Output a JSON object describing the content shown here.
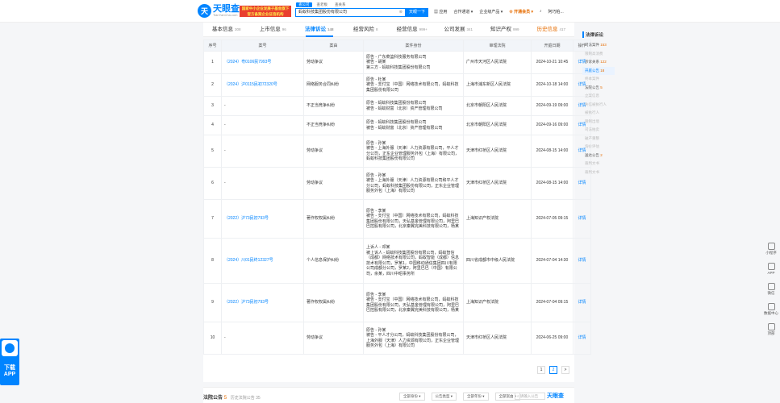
{
  "header": {
    "logo_cn": "天眼查",
    "logo_en": "TianYanCha.com",
    "banner_line1": "国家中小企业发展子基金旗下",
    "banner_line2": "官方备案企业征信机构",
    "search_tabs": [
      "查公司",
      "查老板",
      "查关系"
    ],
    "search_value": "蚂蚁科技集团股份有限公司",
    "search_button": "天眼一下",
    "nav": [
      "应用",
      "合作通道",
      "企业级产品",
      "开通会员",
      "阿巧柏..."
    ]
  },
  "tabs": [
    {
      "label": "基本信息",
      "count": "308"
    },
    {
      "label": "上市信息",
      "count": "96"
    },
    {
      "label": "法律诉讼",
      "count": "148"
    },
    {
      "label": "经营风险",
      "count": "8"
    },
    {
      "label": "经营信息",
      "count": "999+"
    },
    {
      "label": "公司发展",
      "count": "341"
    },
    {
      "label": "知识产权",
      "count": "999"
    },
    {
      "label": "历史信息",
      "count": "417"
    }
  ],
  "table": {
    "headers": [
      "序号",
      "案号",
      "案由",
      "案件身份",
      "审理法院",
      "开庭日期",
      "操作"
    ],
    "rows": [
      {
        "no": "1",
        "case": "（2024）粤0106民7993号",
        "cause": "劳动争议",
        "parties": "原告 - 广东菜篮科技服务有限公司\n被告 - 胡某\n第三方 - 蚂蚁科技集团股份有限公司",
        "court": "广州市天河区人民法院",
        "date": "2024-10-21 10:45",
        "op": "详情"
      },
      {
        "no": "2",
        "case": "（2024）沪0115民初72320号",
        "cause": "网络服务合同纠纷",
        "parties": "原告 - 杜某\n被告 - 支付宝（中国）网络技术有限公司，蚂蚁科技集团股份有限公司",
        "court": "上海市浦东新区人民法院",
        "date": "2024-10-18 14:00",
        "op": "详情"
      },
      {
        "no": "3",
        "case": "-",
        "cause": "不正当竞争纠纷",
        "parties": "原告 - 蚂蚁科技集团股份有限公司\n被告 - 蚂蚁财富（北京）资产管理有限公司",
        "court": "北京市朝阳区人民法院",
        "date": "2024-09-19 09:00",
        "op": "详情"
      },
      {
        "no": "4",
        "case": "-",
        "cause": "不正当竞争纠纷",
        "parties": "原告 - 蚂蚁科技集团股份有限公司\n被告 - 蚂蚁财富（北京）资产管理有限公司",
        "court": "北京市朝阳区人民法院",
        "date": "2024-09-16 09:00",
        "op": "详情"
      },
      {
        "no": "5",
        "case": "-",
        "cause": "劳动争议",
        "parties": "原告 - 孙某\n被告 - 上海外服（天津）人力资源有限公司，平人才分公司，正东企业管理服务外包（上海）有限公司，蚂蚁科技集团股份有限公司",
        "court": "天津市红桥区人民法院",
        "date": "2024-08-15 14:00",
        "op": "详情"
      },
      {
        "no": "6",
        "case": "-",
        "cause": "劳动争议",
        "parties": "原告 - 孙某\n被告 - 上海外服（天津）人力资源有限公司和平人才分公司，蚂蚁科技集团股份有限公司，正东企业管理服务外包（上海）有限公司",
        "court": "天津市红桥区人民法院",
        "date": "2024-08-15 14:00",
        "op": "详情"
      },
      {
        "no": "7",
        "case": "（2022）沪73民初793号",
        "cause": "著作权权属纠纷",
        "parties": "原告 - 李某\n被告 - 支付宝（中国）网络技术有限公司，蚂蚁科技集团股份有限公司，天弘基金管理有限公司，阿里巴巴控股有限公司，北京秦翼完美科技有限公司，杨某",
        "court": "上海知识产权法院",
        "date": "2024-07-05 09:15",
        "op": "详情"
      },
      {
        "no": "8",
        "case": "（2024）川01民终12327号",
        "cause": "个人信息保护纠纷",
        "parties": "上诉人 - 邓某\n被上诉人 - 蚂蚁科技集团股份有限公司，蚂蚁智信（成都）网络技术有限公司，蚂蚁智能（成都）信息技术有限公司，罗某1，中国移动通信集团四川有限公司成都分公司，罗某2，阿里巴巴（中国）有限公司，余某，四川中昭事务所",
        "court": "四川省成都市中级人民法院",
        "date": "2024-07-04 14:30",
        "op": "详情"
      },
      {
        "no": "9",
        "case": "（2022）沪73民初793号",
        "cause": "著作权权属纠纷",
        "parties": "原告 - 李某\n被告 - 支付宝（中国）网络技术有限公司，蚂蚁科技集团股份有限公司，天弘基金管理有限公司，阿里巴巴控股有限公司，北京秦翼完美科技有限公司，杨某",
        "court": "上海知识产权法院",
        "date": "2024-07-04 09:15",
        "op": "详情"
      },
      {
        "no": "10",
        "case": "-",
        "cause": "劳动争议",
        "parties": "原告 - 孙某\n被告 - 平人才分公司，蚂蚁科技集团股份有限公司，上海外服（天津）人力资源有限公司，正东企业管理服务外包（上海）有限公司",
        "court": "天津市红桥区人民法院",
        "date": "2024-06-25 09:00",
        "op": "详情"
      }
    ]
  },
  "pager": [
    "1",
    "2",
    ">"
  ],
  "bottom": {
    "title": "法院公告",
    "count": "5",
    "sub": "历史法院公告 35",
    "filters": [
      "全部身份",
      "公告类型",
      "全部年份",
      "全部案由"
    ],
    "search_placeholder": "请输入公告",
    "brand": "天眼查"
  },
  "sidebar": {
    "title": "法律诉讼",
    "items": [
      {
        "label": "司法案件",
        "n": "153"
      },
      {
        "label": "限制高消费",
        "n": ""
      },
      {
        "label": "涉诉关系",
        "n": "122"
      },
      {
        "label": "开庭公告",
        "n": "18"
      },
      {
        "label": "终本案件",
        "n": ""
      },
      {
        "label": "法院公告",
        "n": "5"
      },
      {
        "label": "立案信息",
        "n": ""
      },
      {
        "label": "失信被执行人",
        "n": ""
      },
      {
        "label": "被执行人",
        "n": ""
      },
      {
        "label": "限制出境",
        "n": ""
      },
      {
        "label": "司法拍卖",
        "n": ""
      },
      {
        "label": "破产重整",
        "n": ""
      },
      {
        "label": "询价评估",
        "n": ""
      },
      {
        "label": "送达公告",
        "n": "2"
      },
      {
        "label": "裁判文书",
        "n": ""
      },
      {
        "label": "裁判文书",
        "n": ""
      }
    ]
  },
  "right_tools": [
    "小程序",
    "APP",
    "微信",
    "数据中心",
    "顶部"
  ],
  "left_app": {
    "line1": "下载",
    "line2": "APP"
  }
}
